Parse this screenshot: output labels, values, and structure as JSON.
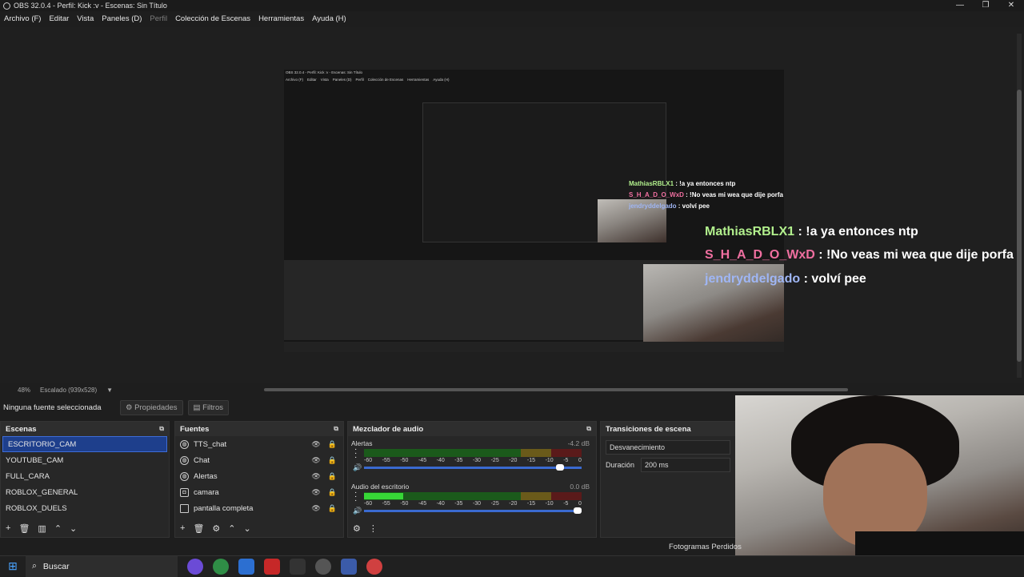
{
  "window": {
    "title": "OBS 32.0.4 - Perfil: Kick :v - Escenas: Sin Título",
    "controls": [
      "—",
      "❐",
      "✕"
    ]
  },
  "menu": [
    {
      "label": "Archivo (F)",
      "enabled": true
    },
    {
      "label": "Editar",
      "enabled": true
    },
    {
      "label": "Vista",
      "enabled": true
    },
    {
      "label": "Paneles (D)",
      "enabled": true
    },
    {
      "label": "Perfil",
      "enabled": false
    },
    {
      "label": "Colección de Escenas",
      "enabled": true
    },
    {
      "label": "Herramientas",
      "enabled": true
    },
    {
      "label": "Ayuda (H)",
      "enabled": true
    }
  ],
  "preview": {
    "nested_title": "OBS 32.0.4 - Perfil: Kick :v - Escenas: Sin Título",
    "nested_menu": [
      "Archivo (F)",
      "Editar",
      "Vista",
      "Paneles (D)",
      "Perfil",
      "Colección de Escenas",
      "Herramientas",
      "Ayuda (H)"
    ],
    "chat_small": [
      {
        "user": "MathiasRBLX1",
        "msg": " : !a ya entonces ntp",
        "color": "#b2f08d"
      },
      {
        "user": "S_H_A_D_O_WxD",
        "msg": " : !No veas mi wea que dije porfa",
        "color": "#f06fa0"
      },
      {
        "user": "jendryddelgado",
        "msg": " : volví pee",
        "color": "#9fb6f5"
      }
    ],
    "chat_large": [
      {
        "user": "MathiasRBLX1",
        "msg": " : !a ya entonces ntp",
        "color": "#b2f08d"
      },
      {
        "user": "S_H_A_D_O_WxD",
        "msg": " : !No veas mi wea que dije porfa",
        "color": "#f06fa0"
      },
      {
        "user": "jendryddelgado",
        "msg": " : volví pee",
        "color": "#9fb6f5"
      }
    ]
  },
  "statusbar": {
    "zoom": "48%",
    "scale": "Escalado (939x528)"
  },
  "properties_bar": {
    "no_source": "Ninguna fuente seleccionada",
    "properties": "Propiedades",
    "filters": "Filtros"
  },
  "scenes": {
    "title": "Escenas",
    "items": [
      "ESCRITORIO_CAM",
      "YOUTUBE_CAM",
      "FULL_CARA",
      "ROBLOX_GENERAL",
      "ROBLOX_DUELS"
    ],
    "selected": 0
  },
  "sources": {
    "title": "Fuentes",
    "items": [
      {
        "label": "TTS_chat",
        "icon": "globe-icon"
      },
      {
        "label": "Chat",
        "icon": "globe-icon"
      },
      {
        "label": "Alertas",
        "icon": "globe-icon"
      },
      {
        "label": "camara",
        "icon": "camera-icon"
      },
      {
        "label": "pantalla completa",
        "icon": "monitor-icon"
      }
    ]
  },
  "mixer": {
    "title": "Mezclador de audio",
    "scale": [
      "-60",
      "-55",
      "-50",
      "-45",
      "-40",
      "-35",
      "-30",
      "-25",
      "-20",
      "-15",
      "-10",
      "-5",
      "0"
    ],
    "channels": [
      {
        "name": "Alertas",
        "db": "-4.2 dB",
        "level": 0.0,
        "volume": 0.92
      },
      {
        "name": "Audio del escritorio",
        "db": "0.0 dB",
        "level": 0.18,
        "volume": 1.0
      }
    ]
  },
  "transitions": {
    "title": "Transiciones de escena",
    "type": "Desvanecimiento",
    "duration_label": "Duración",
    "duration": "200 ms"
  },
  "frames": "Fotogramas Perdidos",
  "taskbar": {
    "search": "Buscar"
  }
}
